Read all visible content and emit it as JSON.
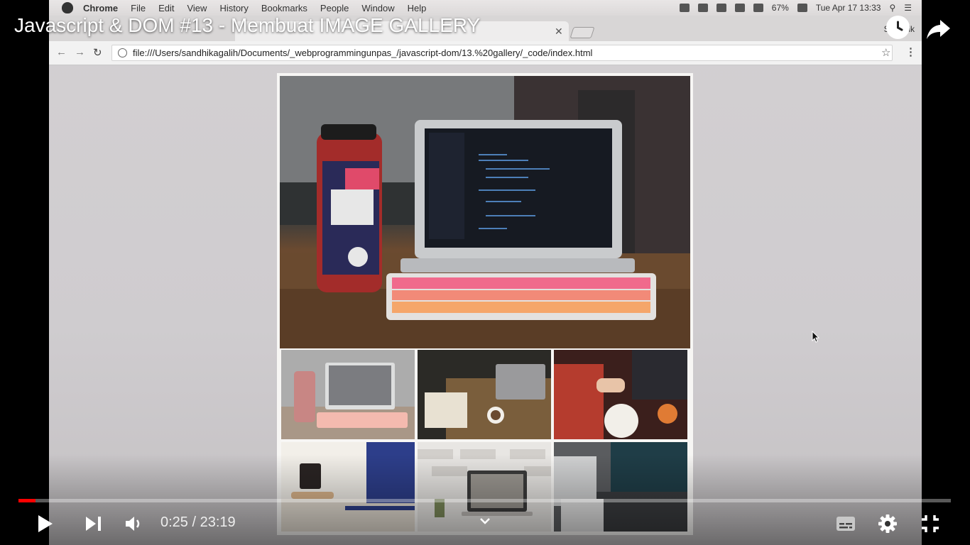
{
  "video": {
    "title": "Javascript & DOM #13 - Membuat IMAGE GALLERY",
    "progress_fraction": 0.018,
    "time": {
      "current": "0:25",
      "separator": " / ",
      "duration": "23:19"
    }
  },
  "mac_menubar": {
    "app": "Chrome",
    "menus": [
      "File",
      "Edit",
      "View",
      "History",
      "Bookmarks",
      "People",
      "Window",
      "Help"
    ],
    "battery": "67%",
    "clock": "Tue Apr 17  13:33"
  },
  "browser": {
    "profile": "Sandhik",
    "url": "file:///Users/sandhikagalih/Documents/_webprogrammingunpas_/javascript-dom/13.%20gallery/_code/index.html"
  },
  "gallery": {
    "images": [
      {
        "subject": "laptop-keyboard-bottle",
        "colors": [
          "#3e4042",
          "#d4d6d8",
          "#f06a8c",
          "#f5a66a"
        ]
      },
      {
        "subject": "desk-coffee-notebook",
        "colors": [
          "#2b2a26",
          "#7a5e3c",
          "#e8e1d2"
        ]
      },
      {
        "subject": "meeting-red-sweater",
        "colors": [
          "#3b1f1c",
          "#b53c2e",
          "#e07b34"
        ]
      },
      {
        "subject": "mug-laptop",
        "colors": [
          "#d9b38a",
          "#2d3e8a",
          "#f2efe9"
        ]
      },
      {
        "subject": "laptop-brick-wall",
        "colors": [
          "#e8e6e3",
          "#9a9690",
          "#3b3b3b"
        ]
      },
      {
        "subject": "laptop-ocean-screen",
        "colors": [
          "#5a5c5f",
          "#1f3d47",
          "#cfd0d1"
        ]
      }
    ],
    "active_index": 0
  }
}
